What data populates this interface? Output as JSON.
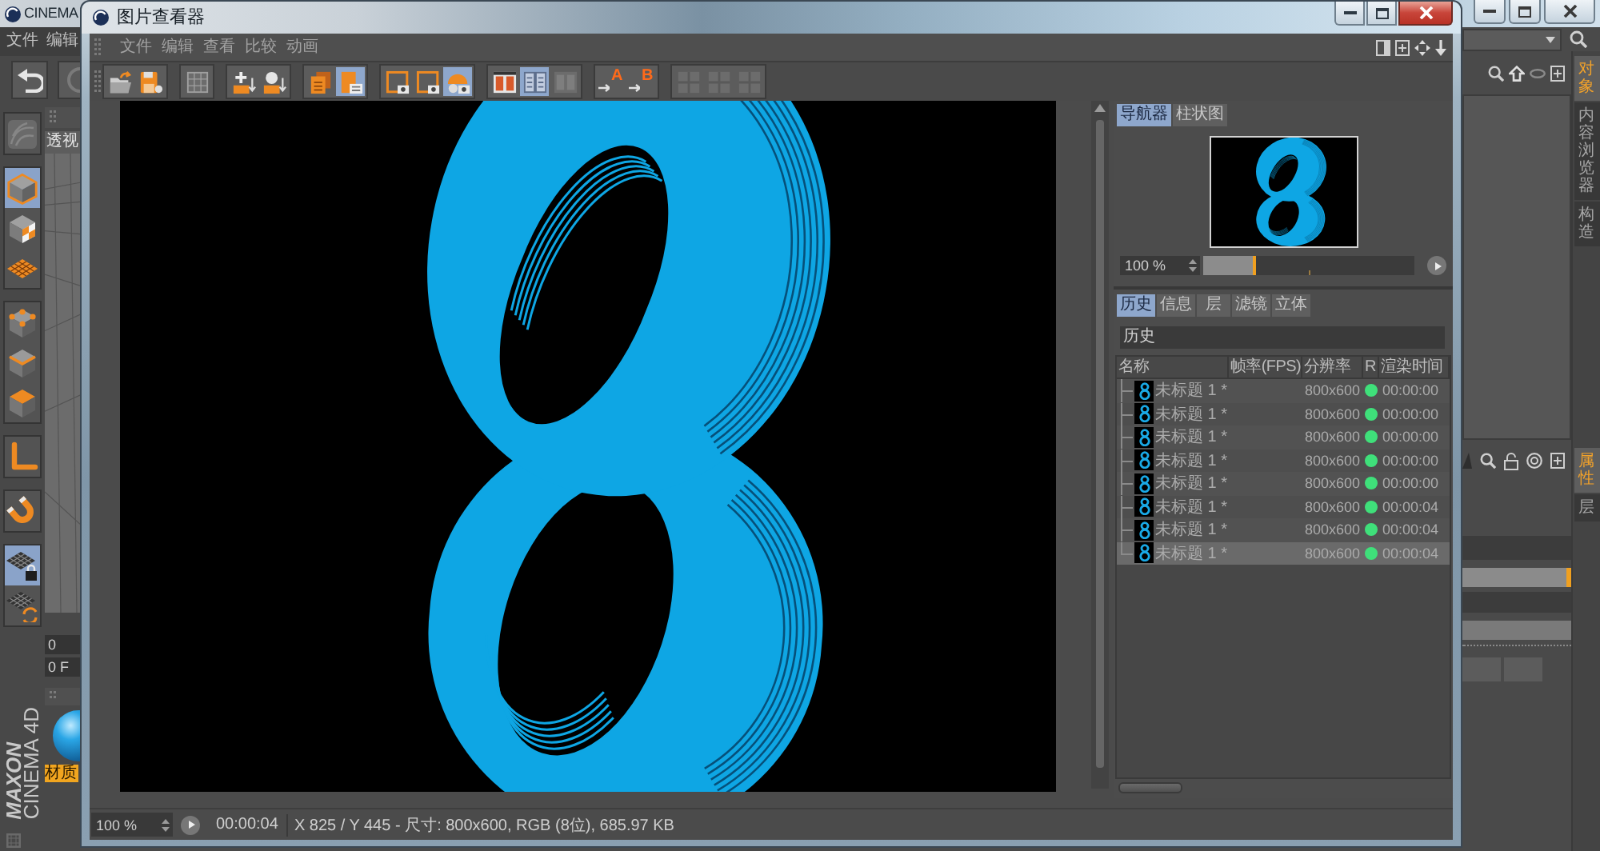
{
  "app": {
    "title": "CINEMA",
    "menu": [
      "文件",
      "编辑"
    ],
    "toolbar": [
      {
        "kind": "undo",
        "disabled": false
      },
      {
        "kind": "redo",
        "disabled": true
      }
    ],
    "tool_groups": [
      [
        {
          "kind": "sculpt",
          "selected": false,
          "disabled": true
        }
      ],
      [
        {
          "kind": "model",
          "selected": true,
          "disabled": false
        },
        {
          "kind": "texture",
          "selected": false,
          "disabled": false
        },
        {
          "kind": "workplane",
          "selected": false,
          "disabled": false
        }
      ],
      [
        {
          "kind": "points",
          "selected": false,
          "disabled": false
        },
        {
          "kind": "edges",
          "selected": false,
          "disabled": false
        },
        {
          "kind": "polygons",
          "selected": false,
          "disabled": false
        }
      ],
      [
        {
          "kind": "axis",
          "selected": false,
          "disabled": false
        }
      ],
      [
        {
          "kind": "snap",
          "selected": false,
          "disabled": false
        }
      ],
      [
        {
          "kind": "lock",
          "selected": true,
          "disabled": false
        },
        {
          "kind": "sync",
          "selected": false,
          "disabled": false
        }
      ]
    ],
    "viewport_label": "透视",
    "fields": [
      "0",
      "0 F"
    ],
    "material_label": "材质",
    "logo": {
      "brand": "MAXON",
      "product": "CINEMA 4D"
    },
    "side_tabs_top": [
      {
        "label": "对象",
        "selected": true
      },
      {
        "label": "内容浏览器",
        "selected": false
      },
      {
        "label": "构造",
        "selected": false
      }
    ],
    "side_tabs_bottom": [
      {
        "label": "属性",
        "selected": true
      },
      {
        "label": "层",
        "selected": false
      }
    ]
  },
  "viewer": {
    "title": "图片查看器",
    "menu": [
      "文件",
      "编辑",
      "查看",
      "比较",
      "动画"
    ],
    "toolbar": [
      [
        {
          "kind": "open",
          "selected": false,
          "disabled": false
        },
        {
          "kind": "save",
          "selected": false,
          "disabled": false
        }
      ],
      [
        {
          "kind": "grid",
          "selected": false,
          "disabled": false
        }
      ],
      [
        {
          "kind": "insert",
          "selected": false,
          "disabled": false
        },
        {
          "kind": "figure",
          "selected": false,
          "disabled": false
        }
      ],
      [
        {
          "kind": "delete",
          "selected": false,
          "disabled": false
        },
        {
          "kind": "copy",
          "selected": true,
          "disabled": false
        }
      ],
      [
        {
          "kind": "region",
          "selected": false,
          "disabled": false
        },
        {
          "kind": "region",
          "selected": false,
          "disabled": false
        },
        {
          "kind": "render",
          "selected": true,
          "disabled": false
        }
      ],
      [
        {
          "kind": "split",
          "selected": false,
          "disabled": false
        },
        {
          "kind": "compare",
          "selected": true,
          "disabled": false
        },
        {
          "kind": "swap",
          "selected": false,
          "disabled": true
        }
      ],
      [
        {
          "kind": "marker",
          "label": "A",
          "selected": false,
          "disabled": false
        },
        {
          "kind": "marker",
          "label": "B",
          "selected": false,
          "disabled": false
        }
      ],
      [
        {
          "kind": "tile",
          "selected": false,
          "disabled": true
        },
        {
          "kind": "tile",
          "selected": false,
          "disabled": true
        },
        {
          "kind": "tile",
          "selected": false,
          "disabled": true
        }
      ]
    ],
    "navigator": {
      "tabs": [
        {
          "label": "导航器",
          "selected": true
        },
        {
          "label": "柱状图",
          "selected": false
        }
      ],
      "zoom": "100 %",
      "slider": {
        "level": 0.25
      }
    },
    "panel_tabs": [
      {
        "label": "历史",
        "selected": true
      },
      {
        "label": "信息",
        "selected": false
      },
      {
        "label": "层",
        "selected": false
      },
      {
        "label": "滤镜",
        "selected": false
      },
      {
        "label": "立体",
        "selected": false
      }
    ],
    "history": {
      "title": "历史",
      "columns": [
        "名称",
        "帧率(FPS)",
        "分辨率",
        "R",
        "渲染时间"
      ],
      "rows": [
        {
          "name": "未标题 1 *",
          "resolution": "800x600",
          "time": "00:00:00",
          "selected": false
        },
        {
          "name": "未标题 1 *",
          "resolution": "800x600",
          "time": "00:00:00",
          "selected": false
        },
        {
          "name": "未标题 1 *",
          "resolution": "800x600",
          "time": "00:00:00",
          "selected": false
        },
        {
          "name": "未标题 1 *",
          "resolution": "800x600",
          "time": "00:00:00",
          "selected": false
        },
        {
          "name": "未标题 1 *",
          "resolution": "800x600",
          "time": "00:00:00",
          "selected": false
        },
        {
          "name": "未标题 1 *",
          "resolution": "800x600",
          "time": "00:00:04",
          "selected": false
        },
        {
          "name": "未标题 1 *",
          "resolution": "800x600",
          "time": "00:00:04",
          "selected": false
        },
        {
          "name": "未标题 1 *",
          "resolution": "800x600",
          "time": "00:00:04",
          "selected": true
        }
      ]
    },
    "status": {
      "zoom": "100 %",
      "time": "00:00:04",
      "info": "X 825 / Y 445 - 尺寸: 800x600, RGB (8位), 685.97 KB"
    }
  }
}
